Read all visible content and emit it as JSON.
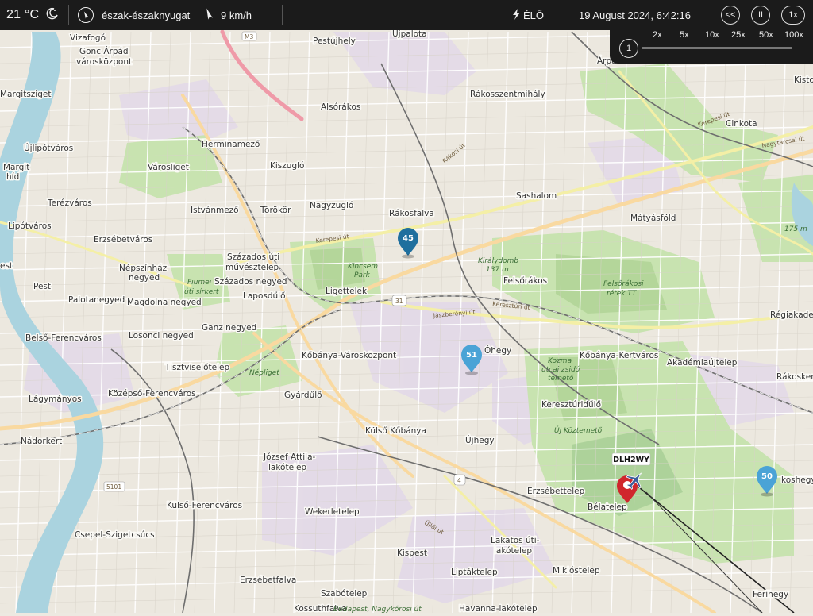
{
  "header": {
    "temperature": "21 °C",
    "wind_direction": "észak-északnyugat",
    "wind_speed": "9 km/h",
    "live_label": "ÉLŐ",
    "datetime": "19 August 2024, 6:42:16",
    "rewind_label": "<<",
    "pause_label": "II",
    "speed_current": "1x"
  },
  "speed_panel": {
    "options": [
      "2x",
      "5x",
      "10x",
      "25x",
      "50x",
      "100x"
    ],
    "slider_value": "1"
  },
  "flight": {
    "callsign": "DLH2WY"
  },
  "markers": [
    {
      "label": "45",
      "color": "#1f6f9e"
    },
    {
      "label": "51",
      "color": "#4aa3d6"
    },
    {
      "label": "50",
      "color": "#4aa3d6"
    },
    {
      "label": "",
      "color": "#d0262d"
    }
  ],
  "map_labels": {
    "places": [
      "Vizafogó",
      "Gonc Árpád",
      "városközpont",
      "Margitsziget",
      "Újlipótváros",
      "Margit",
      "híd",
      "Terézváros",
      "Lipótváros",
      "est",
      "Pest",
      "Erzsébetváros",
      "Palotanegyed",
      "Belső-Ferencváros",
      "Lágymányos",
      "Nádorkert",
      "Herminamező",
      "Városliget",
      "Istvánmező",
      "Kiszugló",
      "Törökör",
      "Nagyzugló",
      "Népszínház",
      "negyed",
      "Magdolna negyed",
      "Százados úti",
      "művésztelep",
      "Százados negyed",
      "Laposdűlő",
      "Ligettelek",
      "Ganz negyed",
      "Losonci negyed",
      "Tisztviselőtelep",
      "Középső-Ferencváros",
      "Kőbánya-Városközpont",
      "Gyárdűlő",
      "Külső Kőbánya",
      "József Attila-",
      "lakótelep",
      "Külső-Ferencváros",
      "Csepel-Szigetcsúcs",
      "Wekerletelep",
      "Erzsébetfalva",
      "Szabótelep",
      "Kispest",
      "Kossuthfalva",
      "Pestújhely",
      "Újpalota",
      "Alsórákos",
      "Rákosszentmihály",
      "Rákosfalva",
      "Sashalom",
      "Mátyásföld",
      "Cinkota",
      "Árpá",
      "Kistor",
      "Felsőrákos",
      "Kőbánya-Kertváros",
      "Akadémiaújtelep",
      "Rákoskere",
      "Régiakade",
      "Keresztúridűlő",
      "Újhegy",
      "Óhegy",
      "Erzsébettelep",
      "Bélatelep",
      "Lakatos úti-",
      "lakótelep",
      "Liptáktelep",
      "Miklóstelep",
      "Havanna-lakótelep",
      "Ferihegy",
      "Rákoskeresztúr",
      "koshegy"
    ],
    "parks": [
      "Kincsem",
      "Park",
      "Fiumei",
      "úti sírkert",
      "Népliget",
      "Királydomb",
      "137 m",
      "Felsőrákosi",
      "rétek TT",
      "Kozma",
      "utcai zsidó",
      "temető",
      "Új Köztemető",
      "Budapest, Nagykőrösi út",
      "175 m"
    ],
    "roads": [
      "M3",
      "31",
      "4",
      "5101",
      "Jászberényi út",
      "Keresztúri út",
      "Kerepesi út",
      "Rákosi út",
      "Nagytarcsai út",
      "Kerepesi út",
      "Üllői út"
    ]
  }
}
